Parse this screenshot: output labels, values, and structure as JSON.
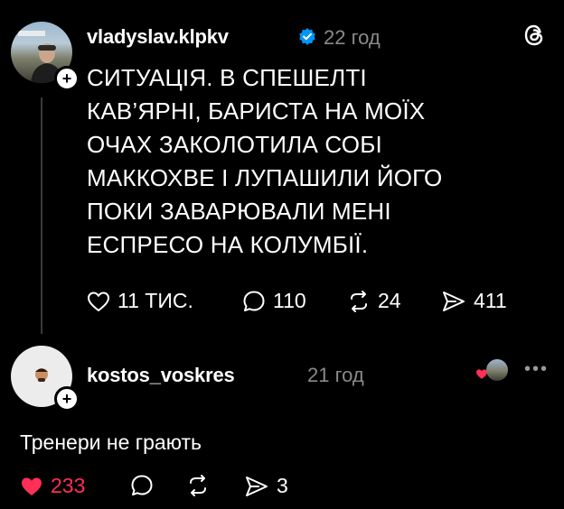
{
  "post": {
    "username": "vladyslav.klpkv",
    "verified": true,
    "time": "22 год",
    "text": "СИТУАЦІЯ. В СПЕШЕЛТІ\nКАВ’ЯРНІ, БАРИСТА НА МОЇХ\nОЧАХ ЗАКОЛОТИЛА СОБІ\nМАККОХВЕ І ЛУПАШИЛИ ЙОГО\nПОКИ ЗАВАРЮВАЛИ МЕНІ\nЕСПРЕСО НА КОЛУМБІЇ.",
    "likes": "11 ТИС.",
    "comments": "110",
    "reposts": "24",
    "shares": "411"
  },
  "reply": {
    "username": "kostos_voskres",
    "time": "21 год",
    "text": "Тренери не грають",
    "likes": "233",
    "shares": "3"
  },
  "icons": {
    "app": "threads-logo-icon",
    "verified": "verified-badge-icon",
    "like": "heart-icon",
    "comment": "comment-bubble-icon",
    "repost": "repost-icon",
    "share": "send-icon",
    "more": "more-dots-icon"
  },
  "colors": {
    "background": "#000000",
    "text": "#ffffff",
    "muted": "#8a8a8a",
    "like_active": "#ff2f55",
    "verified": "#0095f6"
  }
}
